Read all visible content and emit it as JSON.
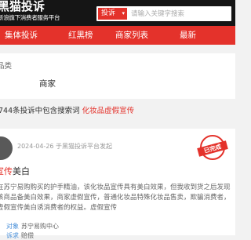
{
  "header": {
    "logo": "黑猫投诉",
    "slogan": "新浪旗下消费者服务平台",
    "search": {
      "type": "投诉",
      "caret": "▾",
      "placeholder": "请输入关键字搜索"
    }
  },
  "nav": {
    "items": [
      "集体投诉",
      "红黑榜",
      "商家列表",
      "最新"
    ]
  },
  "filter": {
    "label": "品类",
    "value": "商家"
  },
  "result": {
    "prefix": "744条投诉中包含搜索词",
    "keyword": "化妆品虚假宣传"
  },
  "complaint": {
    "date": "2024-04-26 于黑猫投诉平台发起",
    "status": "已完成",
    "title_keyword": "宣传",
    "title_suffix": "美白",
    "body": "在苏宁易购购买的护手精油，该化妆品宣传具有美白效果，但我收到货之后发现该商品备美白效果，商家虚假宣传，普通化妆品特殊化妆品售卖，欺骗消费者，虚假宣传美白诱消费者的权益。虚假宣传",
    "merchant_key": "对象",
    "merchant": "苏宁易购中心",
    "demand_key": "诉求",
    "demand": "赔偿"
  }
}
